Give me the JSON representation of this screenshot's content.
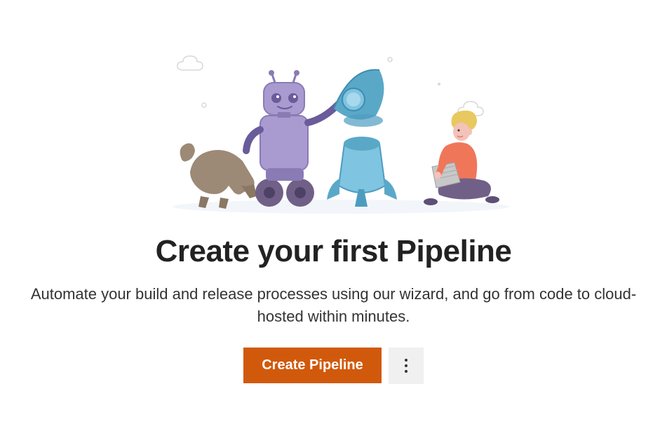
{
  "empty_state": {
    "heading": "Create your first Pipeline",
    "description": "Automate your build and release processes using our wizard, and go from code to cloud-hosted within minutes.",
    "primary_button_label": "Create Pipeline",
    "more_button_aria": "More actions"
  },
  "colors": {
    "primary": "#d1590c",
    "text_heading": "#222222",
    "text_body": "#333333",
    "secondary_bg": "#f0f0f0"
  }
}
